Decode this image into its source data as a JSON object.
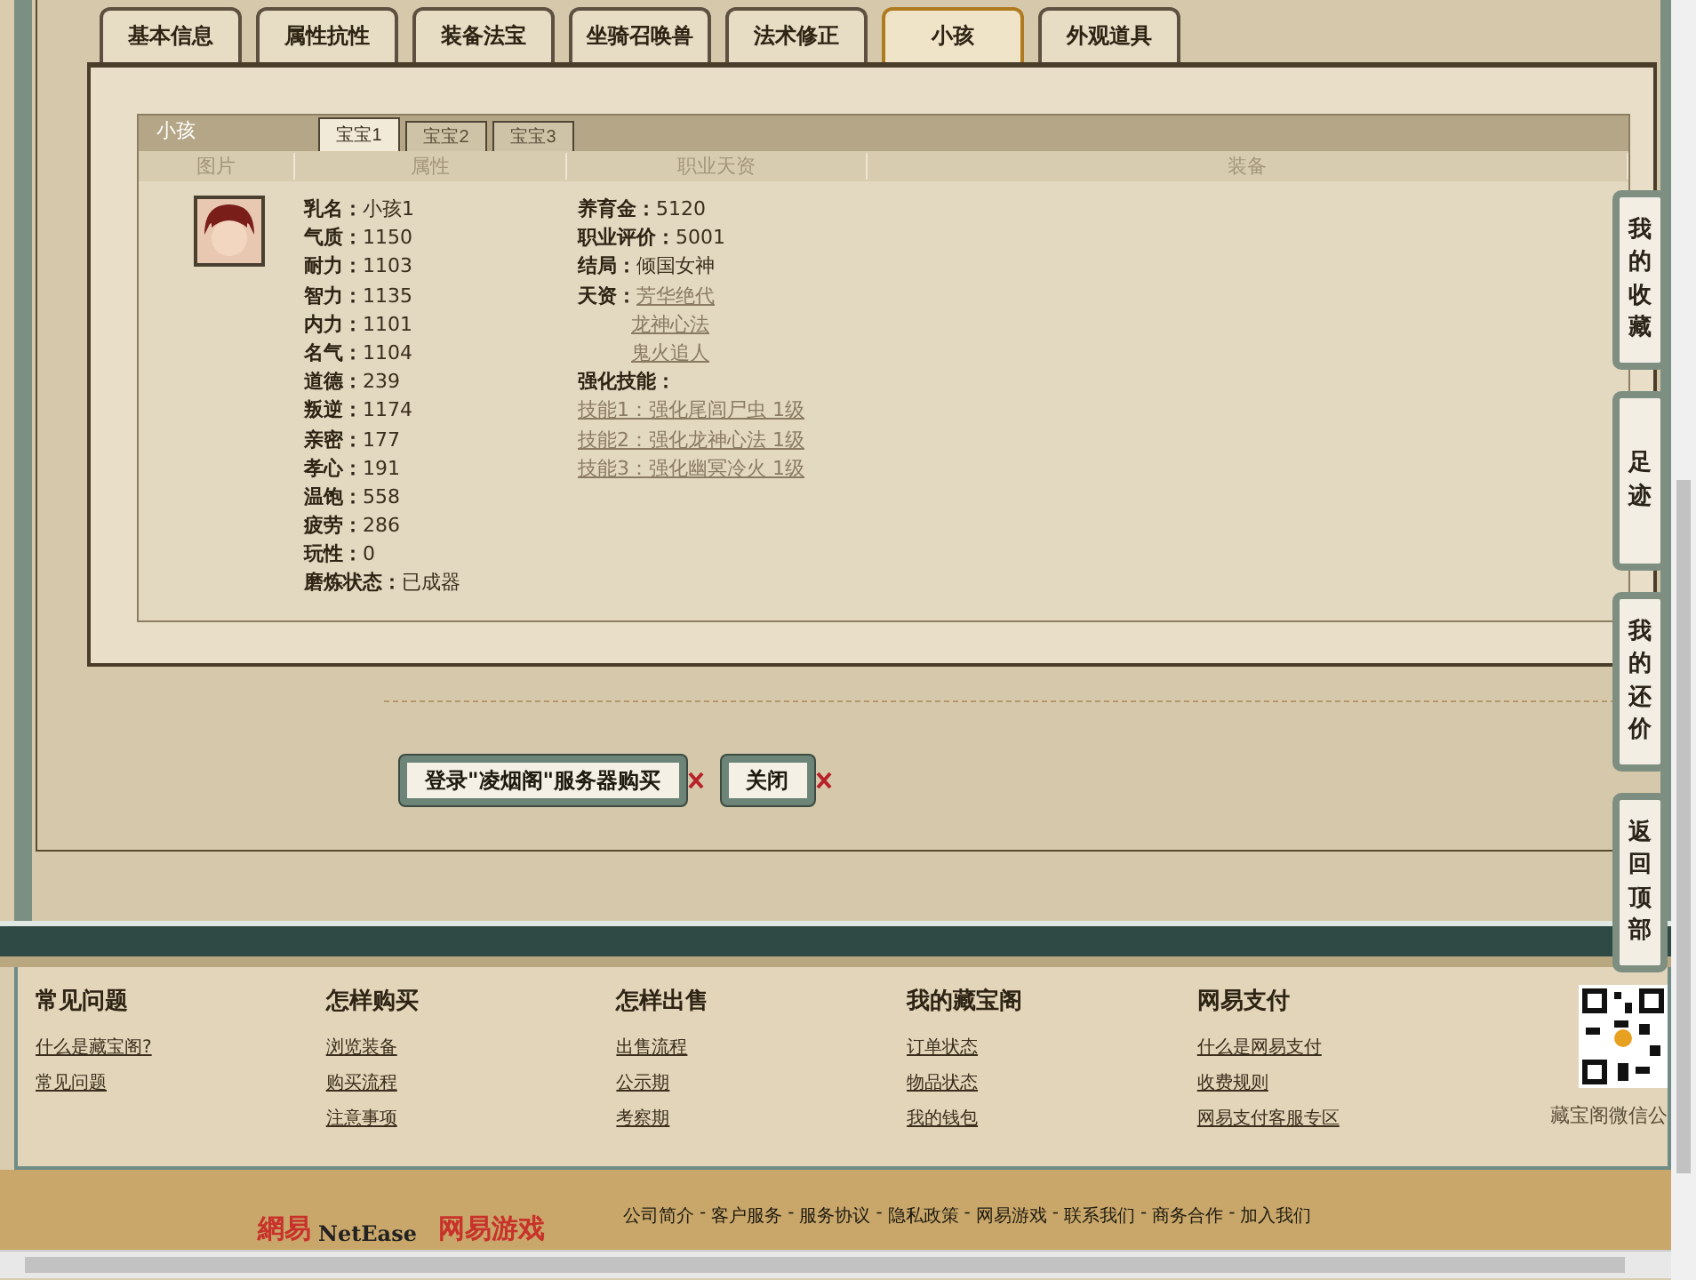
{
  "tabs": [
    {
      "label": "基本信息",
      "selected": false
    },
    {
      "label": "属性抗性",
      "selected": false
    },
    {
      "label": "装备法宝",
      "selected": false
    },
    {
      "label": "坐骑召唤兽",
      "selected": false
    },
    {
      "label": "法术修正",
      "selected": false
    },
    {
      "label": "小孩",
      "selected": true
    },
    {
      "label": "外观道具",
      "selected": false
    }
  ],
  "child_panel": {
    "title": "小孩",
    "subtabs": [
      {
        "label": "宝宝1",
        "selected": true
      },
      {
        "label": "宝宝2",
        "selected": false
      },
      {
        "label": "宝宝3",
        "selected": false
      }
    ],
    "columns": [
      "图片",
      "属性",
      "职业天资",
      "装备"
    ],
    "attributes": [
      {
        "label": "乳名：",
        "value": "小孩1"
      },
      {
        "label": "气质：",
        "value": "1150"
      },
      {
        "label": "耐力：",
        "value": "1103"
      },
      {
        "label": "智力：",
        "value": "1135"
      },
      {
        "label": "内力：",
        "value": "1101"
      },
      {
        "label": "名气：",
        "value": "1104"
      },
      {
        "label": "道德：",
        "value": "239"
      },
      {
        "label": "叛逆：",
        "value": "1174"
      },
      {
        "label": "亲密：",
        "value": "177"
      },
      {
        "label": "孝心：",
        "value": "191"
      },
      {
        "label": "温饱：",
        "value": "558"
      },
      {
        "label": "疲劳：",
        "value": "286"
      },
      {
        "label": "玩性：",
        "value": "0"
      },
      {
        "label": "磨炼状态：",
        "value": "已成器"
      }
    ],
    "career": [
      {
        "label": "养育金：",
        "value": "5120"
      },
      {
        "label": "职业评价：",
        "value": "5001"
      },
      {
        "label": "结局：",
        "value": "倾国女神"
      }
    ],
    "talents": {
      "label": "天资：",
      "items": [
        "芳华绝代",
        "龙神心法",
        "鬼火追人"
      ]
    },
    "skills": {
      "label": "强化技能：",
      "items": [
        "技能1：强化尾闾尸虫 1级",
        "技能2：强化龙神心法 1级",
        "技能3：强化幽冥冷火 1级"
      ]
    }
  },
  "buttons": [
    "登录\"凌烟阁\"服务器购买",
    "关闭"
  ],
  "side_buttons": [
    "我的收藏",
    "足迹",
    "我的还价",
    "返回顶部"
  ],
  "footer": {
    "columns": [
      {
        "heading": "常见问题",
        "links": [
          "什么是藏宝阁?",
          "常见问题"
        ]
      },
      {
        "heading": "怎样购买",
        "links": [
          "浏览装备",
          "购买流程",
          "注意事项"
        ]
      },
      {
        "heading": "怎样出售",
        "links": [
          "出售流程",
          "公示期",
          "考察期"
        ]
      },
      {
        "heading": "我的藏宝阁",
        "links": [
          "订单状态",
          "物品状态",
          "我的钱包"
        ]
      },
      {
        "heading": "网易支付",
        "links": [
          "什么是网易支付",
          "收费规则",
          "网易支付客服专区"
        ]
      }
    ],
    "qr_caption": "藏宝阁微信公",
    "logos": [
      "網易",
      "NetEase",
      "网易游戏"
    ],
    "separator": "-",
    "bottom_links": [
      "公司简介",
      "客户服务",
      "服务协议",
      "隐私政策",
      "网易游戏",
      "联系我们",
      "商务合作",
      "加入我们"
    ]
  }
}
